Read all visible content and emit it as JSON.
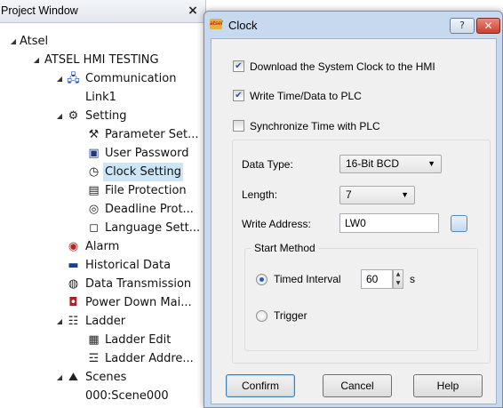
{
  "project_window": {
    "title": "Project Window",
    "close_glyph": "×",
    "tree": [
      {
        "id": "atsel",
        "label": "Atsel",
        "expander": "◢",
        "icon": ""
      },
      {
        "id": "atsel-hmi-testing",
        "label": "ATSEL HMI TESTING",
        "expander": "◢",
        "icon": ""
      },
      {
        "id": "communication",
        "label": "Communication",
        "expander": "◢",
        "icon": "network-icon"
      },
      {
        "id": "link1",
        "label": "Link1",
        "expander": "",
        "icon": ""
      },
      {
        "id": "setting",
        "label": "Setting",
        "expander": "◢",
        "icon": "gear-icon"
      },
      {
        "id": "parameter-set",
        "label": "Parameter Set...",
        "expander": "",
        "icon": "tools-icon"
      },
      {
        "id": "user-password",
        "label": "User Password",
        "expander": "",
        "icon": "password-icon"
      },
      {
        "id": "clock-setting",
        "label": "Clock Setting",
        "expander": "",
        "icon": "clock-icon",
        "selected": true
      },
      {
        "id": "file-protection",
        "label": "File Protection",
        "expander": "",
        "icon": "file-protection-icon"
      },
      {
        "id": "deadline-prot",
        "label": "Deadline Prot...",
        "expander": "",
        "icon": "deadline-icon"
      },
      {
        "id": "language-sett",
        "label": "Language Sett...",
        "expander": "",
        "icon": "language-icon"
      },
      {
        "id": "alarm",
        "label": "Alarm",
        "expander": "",
        "icon": "alarm-icon"
      },
      {
        "id": "historical-data",
        "label": "Historical Data",
        "expander": "",
        "icon": "save-icon"
      },
      {
        "id": "data-transmission",
        "label": "Data Transmission",
        "expander": "",
        "icon": "transmission-icon"
      },
      {
        "id": "power-down-mai",
        "label": "Power Down Mai...",
        "expander": "",
        "icon": "power-down-icon"
      },
      {
        "id": "ladder",
        "label": "Ladder",
        "expander": "◢",
        "icon": "ladder-icon"
      },
      {
        "id": "ladder-edit",
        "label": "Ladder Edit",
        "expander": "",
        "icon": "ladder-edit-icon"
      },
      {
        "id": "ladder-addre",
        "label": "Ladder Addre...",
        "expander": "",
        "icon": "ladder-address-icon"
      },
      {
        "id": "scenes",
        "label": "Scenes",
        "expander": "◢",
        "icon": "scenes-icon"
      },
      {
        "id": "scene000",
        "label": "000:Scene000",
        "expander": "",
        "icon": ""
      }
    ]
  },
  "dialog": {
    "title": "Clock",
    "app_icon_text": "atsel",
    "help_glyph": "?",
    "close_glyph": "✕",
    "options": [
      {
        "id": "download-clock",
        "label": "Download the System Clock to the HMI",
        "checked": true
      },
      {
        "id": "write-time",
        "label": "Write Time/Data to PLC",
        "checked": true
      },
      {
        "id": "sync-time",
        "label": "Synchronize Time with PLC",
        "checked": false
      }
    ],
    "check_glyph": "✔",
    "data_type_label": "Data Type:",
    "data_type_value": "16-Bit BCD",
    "length_label": "Length:",
    "length_value": "7",
    "write_address_label": "Write Address:",
    "write_address_value": "LW0",
    "start_method": {
      "legend": "Start Method",
      "timed_interval_label": "Timed Interval",
      "interval_value": "60",
      "interval_unit": "s",
      "trigger_label": "Trigger",
      "selected": "timed_interval"
    },
    "combo_arrow": "▼",
    "spin_up": "▲",
    "spin_down": "▼",
    "confirm_label": "Confirm",
    "cancel_label": "Cancel",
    "help_label": "Help"
  },
  "colors": {
    "selection": "#cde6f7",
    "dialog_frame": "#c6d9ee",
    "close_red": "#c8402e"
  }
}
